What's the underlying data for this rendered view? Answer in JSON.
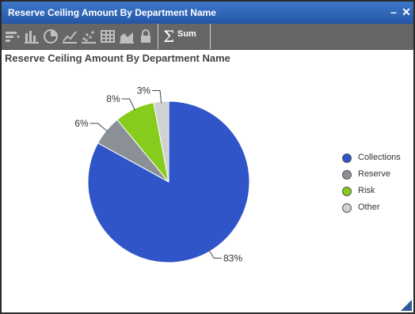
{
  "window": {
    "title": "Reserve Ceiling Amount By Department Name",
    "minimize_icon": "minimize-icon",
    "close_icon": "close-icon"
  },
  "toolbar": {
    "icons": [
      "sort-icon",
      "bar-chart-icon",
      "pie-chart-icon",
      "line-chart-icon",
      "scatter-chart-icon",
      "table-icon",
      "area-chart-icon",
      "lock-icon"
    ],
    "sum_label": "Sum"
  },
  "colors": {
    "titlebar": "#2e61b3",
    "toolbar": "#666666",
    "Collections": "#2f55c8",
    "Reserve": "#8a9096",
    "Risk": "#86cc1c",
    "Other": "#cfd1d3"
  },
  "chart_data": {
    "type": "pie",
    "title": "Reserve Ceiling Amount By Department Name",
    "categories": [
      "Collections",
      "Reserve",
      "Risk",
      "Other"
    ],
    "values": [
      83,
      6,
      8,
      3
    ],
    "labels": [
      "83%",
      "6%",
      "8%",
      "3%"
    ],
    "legend_position": "right"
  }
}
